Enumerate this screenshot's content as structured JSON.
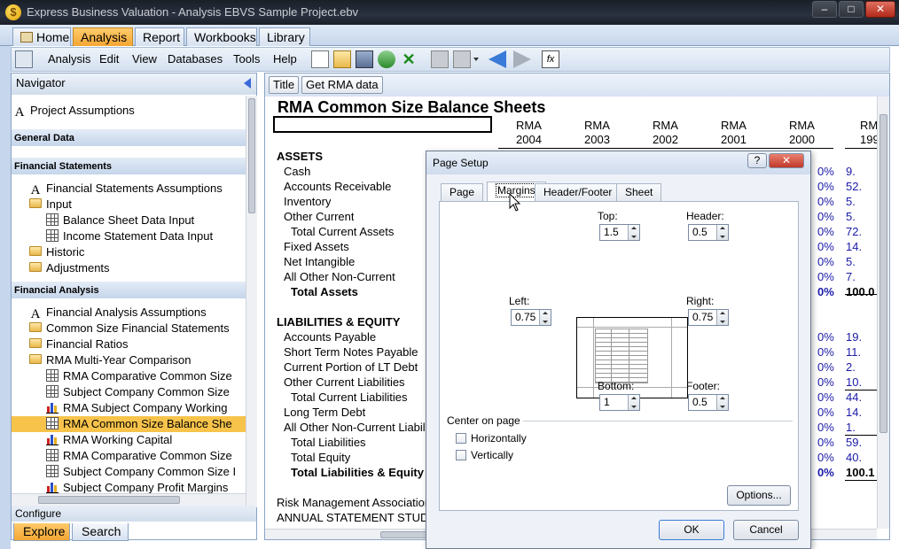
{
  "window": {
    "title": "Express Business Valuation - Analysis EBVS Sample Project.ebv",
    "app_icon": "$",
    "controls": [
      "–",
      "□",
      "✕"
    ]
  },
  "main_tabs": [
    {
      "label": "Home"
    },
    {
      "label": "Analysis"
    },
    {
      "label": "Report"
    },
    {
      "label": "Workbooks"
    },
    {
      "label": "Library"
    }
  ],
  "menu": [
    "Analysis",
    "Edit",
    "View",
    "Databases",
    "Tools",
    "Help"
  ],
  "navigator": {
    "title": "Navigator",
    "project_item": "Project Assumptions",
    "sections": {
      "general": "General Data",
      "financial_statements": "Financial Statements",
      "financial_analysis": "Financial Analysis"
    },
    "fs_items": [
      "Financial Statements Assumptions",
      "Input",
      "Balance Sheet Data Input",
      "Income Statement Data Input",
      "Historic",
      "Adjustments"
    ],
    "fa_items": [
      "Financial Analysis Assumptions",
      "Common Size Financial Statements",
      "Financial Ratios",
      "RMA Multi-Year Comparison",
      "RMA Comparative Common Size",
      "Subject Company Common Size",
      "RMA Subject Company Working",
      "RMA Common Size Balance She",
      "RMA Working Capital",
      "RMA Comparative Common Size",
      "Subject Company Common Size I",
      "Subject Company Profit Margins"
    ],
    "configure": "Configure",
    "bottom_tabs": [
      "Explore",
      "Search"
    ]
  },
  "doc_toolbar": {
    "title_btn": "Title",
    "rma_btn": "Get RMA data"
  },
  "sheet": {
    "title": "RMA Common Size Balance Sheets",
    "col_headers": [
      {
        "top": "RMA",
        "year": "2004"
      },
      {
        "top": "RMA",
        "year": "2003"
      },
      {
        "top": "RMA",
        "year": "2002"
      },
      {
        "top": "RMA",
        "year": "2001"
      },
      {
        "top": "RMA",
        "year": "2000"
      },
      {
        "top": "RM",
        "year": "199"
      }
    ],
    "assets_label": "ASSETS",
    "assets": [
      "Cash",
      "Accounts Receivable",
      "Inventory",
      "Other Current",
      "Total Current Assets",
      "Fixed Assets",
      "Net Intangible",
      "All Other Non-Current",
      "Total Assets"
    ],
    "asset_pct": [
      "0%",
      "0%",
      "0%",
      "0%",
      "0%",
      "0%",
      "0%",
      "0%",
      "0%"
    ],
    "asset_last": [
      "9.",
      "52.",
      "5.",
      "5.",
      "72.",
      "14.",
      "5.",
      "7.",
      "100.0"
    ],
    "liab_label": "LIABILITIES & EQUITY",
    "liabilities": [
      "Accounts Payable",
      "Short Term Notes Payable",
      "Current Portion of LT Debt",
      "Other Current Liabilities",
      "Total Current Liabilities",
      "Long Term Debt",
      "All Other Non-Current Liabili",
      "Total Liabilities",
      "Total Equity",
      "Total Liabilities & Equity"
    ],
    "liab_pct": [
      "0%",
      "0%",
      "0%",
      "0%",
      "0%",
      "0%",
      "0%",
      "0%",
      "0%",
      "0%"
    ],
    "liab_last": [
      "19.",
      "11.",
      "2.",
      "10.",
      "44.",
      "14.",
      "1.",
      "59.",
      "40.",
      "100.1"
    ],
    "footer1": "Risk Management Association",
    "footer2": "ANNUAL STATEMENT STUDIE"
  },
  "dialog": {
    "title": "Page Setup",
    "help": "?",
    "close": "✕",
    "tabs": [
      "Page",
      "Margins",
      "Header/Footer",
      "Sheet"
    ],
    "top_label": "Top:",
    "top_value": "1.5",
    "header_label": "Header:",
    "header_value": "0.5",
    "left_label": "Left:",
    "left_value": "0.75",
    "right_label": "Right:",
    "right_value": "0.75",
    "bottom_label": "Bottom:",
    "bottom_value": "1",
    "footer_label": "Footer:",
    "footer_value": "0.5",
    "center_label": "Center on page",
    "horizontally": "Horizontally",
    "vertically": "Vertically",
    "options": "Options...",
    "ok": "OK",
    "cancel": "Cancel"
  },
  "colors": {
    "accent_tab": "#f4a632",
    "selected_nav": "#f7c34b",
    "blue_values": "#1a1aa8"
  }
}
